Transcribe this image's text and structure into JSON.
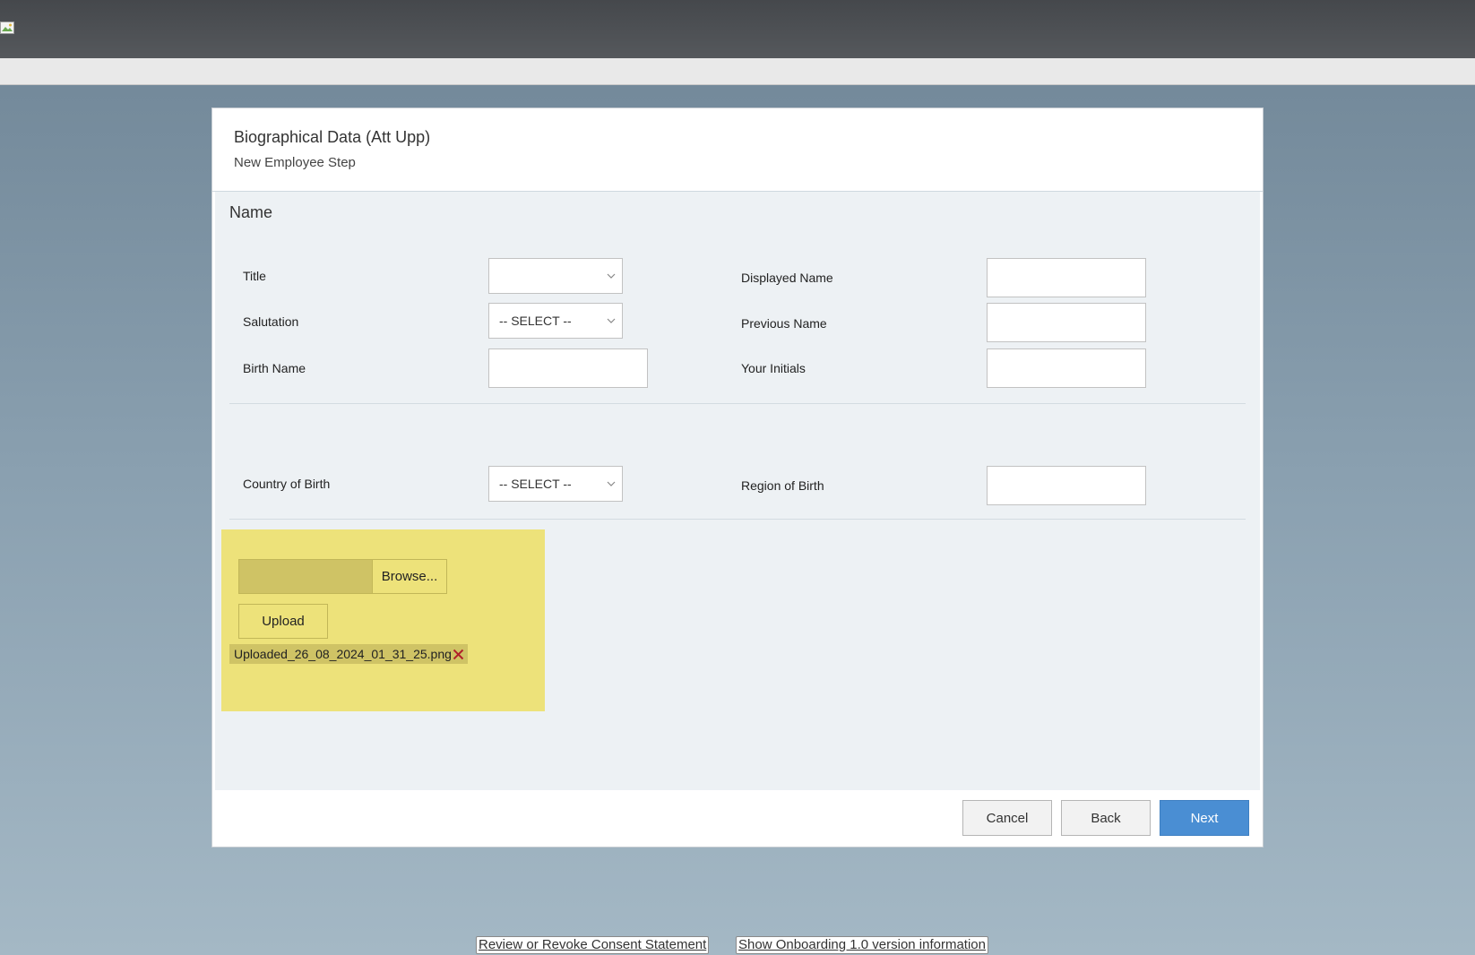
{
  "dialog": {
    "title": "Biographical Data (Att Upp)",
    "subtitle": "New Employee Step"
  },
  "section": {
    "title": "Name"
  },
  "fields": {
    "title_label": "Title",
    "title_value": "",
    "salutation_label": "Salutation",
    "salutation_value": "-- SELECT --",
    "birth_name_label": "Birth Name",
    "birth_name_value": "",
    "displayed_name_label": "Displayed Name",
    "displayed_name_value": "",
    "previous_name_label": "Previous Name",
    "previous_name_value": "",
    "your_initials_label": "Your Initials",
    "your_initials_value": "",
    "country_of_birth_label": "Country of Birth",
    "country_of_birth_value": "-- SELECT --",
    "region_of_birth_label": "Region of Birth",
    "region_of_birth_value": ""
  },
  "upload": {
    "browse_label": "Browse...",
    "upload_label": "Upload",
    "uploaded_file": "Uploaded_26_08_2024_01_31_25.png"
  },
  "buttons": {
    "cancel": "Cancel",
    "back": "Back",
    "next": "Next"
  },
  "footer": {
    "consent_link": "Review or Revoke Consent Statement",
    "version_link": "Show Onboarding 1.0 version information"
  },
  "colors": {
    "primary_button": "#4a8ed3",
    "upload_panel": "#ede27a",
    "remove_icon": "#b0202a"
  },
  "icons": {
    "chevron": "chevron-down-icon",
    "remove": "close-icon",
    "broken_image": "broken-image-icon"
  }
}
